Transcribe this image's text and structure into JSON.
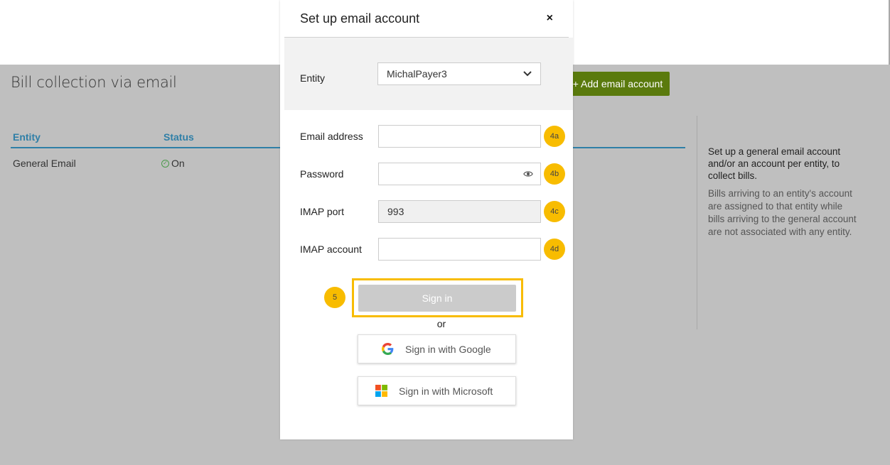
{
  "page": {
    "title": "Bill collection via email",
    "add_button": "+ Add email account",
    "table": {
      "headers": [
        "Entity",
        "Status"
      ],
      "rows": [
        {
          "entity": "General Email",
          "status": "On"
        }
      ]
    },
    "side_panel": {
      "lead": "Set up a general email account and/or an account per entity, to collect bills.",
      "note": "Bills arriving to an entity's account are assigned to that entity while bills arriving to the general account are not associated with any entity."
    }
  },
  "modal": {
    "title": "Set up email account",
    "close_icon": "×",
    "entity": {
      "label": "Entity",
      "value": "MichalPayer3"
    },
    "fields": {
      "email": {
        "label": "Email address",
        "value": "",
        "badge": "4a"
      },
      "password": {
        "label": "Password",
        "value": "",
        "badge": "4b"
      },
      "imap_port": {
        "label": "IMAP port",
        "value": "993",
        "badge": "4c"
      },
      "imap_account": {
        "label": "IMAP account",
        "value": "",
        "badge": "4d"
      }
    },
    "signin": {
      "label": "Sign in",
      "badge": "5"
    },
    "or_text": "or",
    "google": {
      "label": "Sign in with Google",
      "icon": "google-icon"
    },
    "microsoft": {
      "label": "Sign in with Microsoft",
      "icon": "microsoft-icon"
    }
  },
  "colors": {
    "accent_green": "#5a7a0d",
    "table_header_blue": "#2f7fa7",
    "badge_yellow": "#f8bc00",
    "overlay_gray": "#bfbfbf"
  }
}
